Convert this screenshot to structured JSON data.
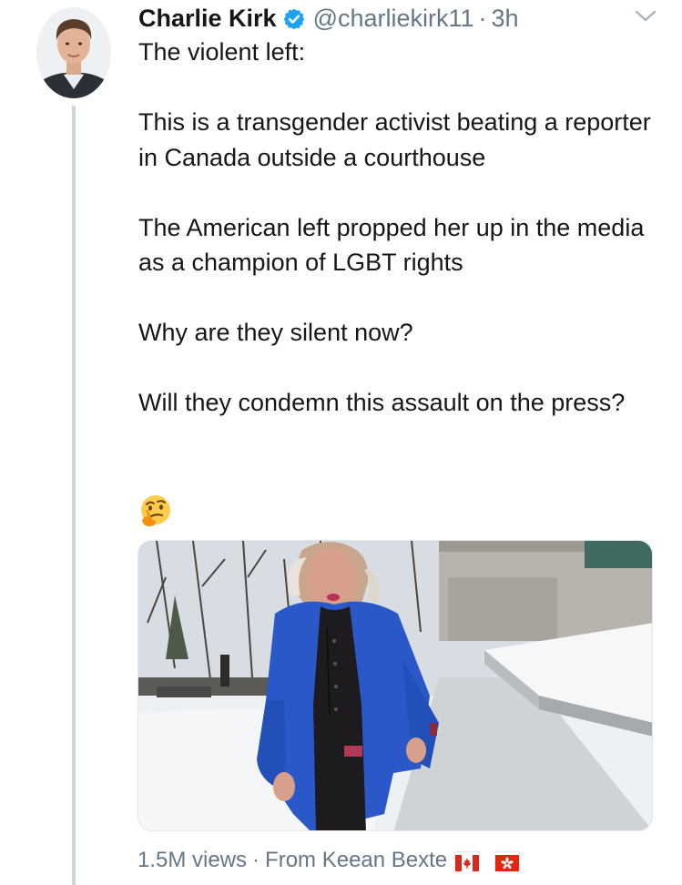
{
  "tweet": {
    "author": {
      "name": "Charlie Kirk",
      "handle": "@charliekirk11",
      "verified": true
    },
    "separator": "·",
    "time": "3h",
    "paragraphs": [
      "The violent left:",
      "This is a transgender activist beating a reporter in Canada outside a courthouse",
      "The American left propped her up in the media as a champion of LGBT rights",
      "Why are they silent now?",
      "Will they condemn this assault on the press?"
    ],
    "emoji": "thinking-face-icon",
    "media": {
      "type": "video-thumbnail"
    },
    "footer": {
      "views": "1.5M views",
      "separator": "·",
      "source": "From Keean Bexte",
      "flags": [
        "canada-flag-icon",
        "hong-kong-flag-icon"
      ]
    }
  },
  "colors": {
    "text": "#14171a",
    "secondary": "#657786",
    "verified": "#1da1f2",
    "thread_line": "#ccd6dd",
    "jacket_blue": "#2a58c9"
  }
}
